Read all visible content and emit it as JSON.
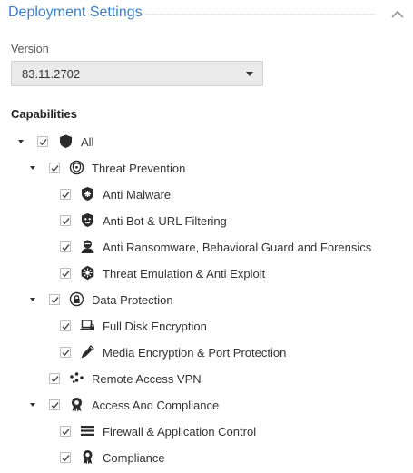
{
  "header": {
    "title": "Deployment Settings",
    "collapse_icon": "chevron-up-icon"
  },
  "version": {
    "label": "Version",
    "value": "83.11.2702"
  },
  "capabilities": {
    "label": "Capabilities",
    "items": [
      {
        "label": "All",
        "level": 0,
        "expandable": true,
        "checked": true,
        "icon": "shield-icon"
      },
      {
        "label": "Threat Prevention",
        "level": 1,
        "expandable": true,
        "checked": true,
        "icon": "threat-prevention-icon"
      },
      {
        "label": "Anti Malware",
        "level": 2,
        "expandable": false,
        "checked": true,
        "icon": "anti-malware-shield-icon"
      },
      {
        "label": "Anti Bot & URL Filtering",
        "level": 2,
        "expandable": false,
        "checked": true,
        "icon": "anti-bot-icon"
      },
      {
        "label": "Anti Ransomware, Behavioral Guard and Forensics",
        "level": 2,
        "expandable": false,
        "checked": true,
        "icon": "ransomware-person-icon"
      },
      {
        "label": "Threat Emulation & Anti Exploit",
        "level": 2,
        "expandable": false,
        "checked": true,
        "icon": "threat-emulation-icon"
      },
      {
        "label": "Data Protection",
        "level": 1,
        "expandable": true,
        "checked": true,
        "icon": "data-protection-icon"
      },
      {
        "label": "Full Disk Encryption",
        "level": 2,
        "expandable": false,
        "checked": true,
        "icon": "laptop-lock-icon"
      },
      {
        "label": "Media Encryption & Port Protection",
        "level": 2,
        "expandable": false,
        "checked": true,
        "icon": "usb-drive-icon"
      },
      {
        "label": "Remote Access VPN",
        "level": 1,
        "expandable": false,
        "checked": true,
        "icon": "vpn-network-icon"
      },
      {
        "label": "Access And Compliance",
        "level": 1,
        "expandable": true,
        "checked": true,
        "icon": "access-compliance-icon"
      },
      {
        "label": "Firewall & Application Control",
        "level": 2,
        "expandable": false,
        "checked": true,
        "icon": "firewall-icon"
      },
      {
        "label": "Compliance",
        "level": 2,
        "expandable": false,
        "checked": true,
        "icon": "compliance-ribbon-icon"
      }
    ]
  },
  "colors": {
    "title": "#3b7fc4",
    "icon": "#2b2b2b",
    "select_bg": "#eaeaea"
  }
}
